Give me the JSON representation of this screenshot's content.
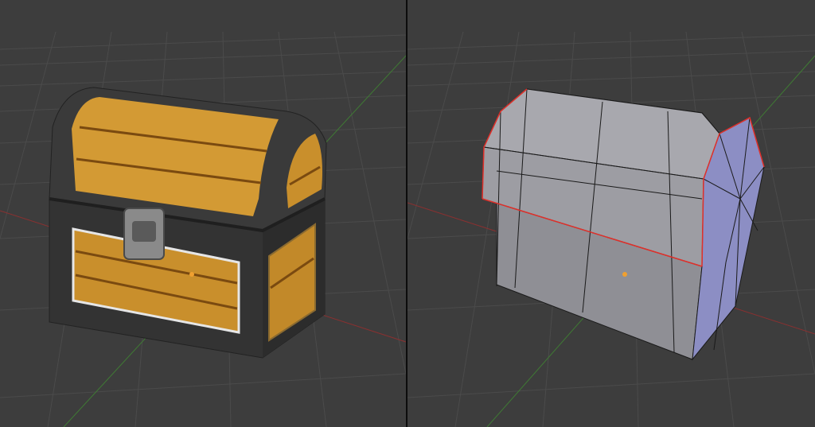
{
  "viewports": [
    {
      "mode": "textured",
      "object": "treasure-chest"
    },
    {
      "mode": "wireframe",
      "object": "treasure-chest"
    }
  ],
  "colors": {
    "background": "#3d3d3d",
    "grid": "#4a4a4a",
    "x_axis": "#8a3030",
    "y_axis": "#3f7a34",
    "wood": "#d39a34",
    "wood_dark": "#7a4a10",
    "iron": "#3b3b3b",
    "latch": "#8a8a8a",
    "mesh_face": "#8f8f95",
    "mesh_side": "#8c8ec4",
    "seam": "#e0302a",
    "origin": "#f0a030"
  }
}
